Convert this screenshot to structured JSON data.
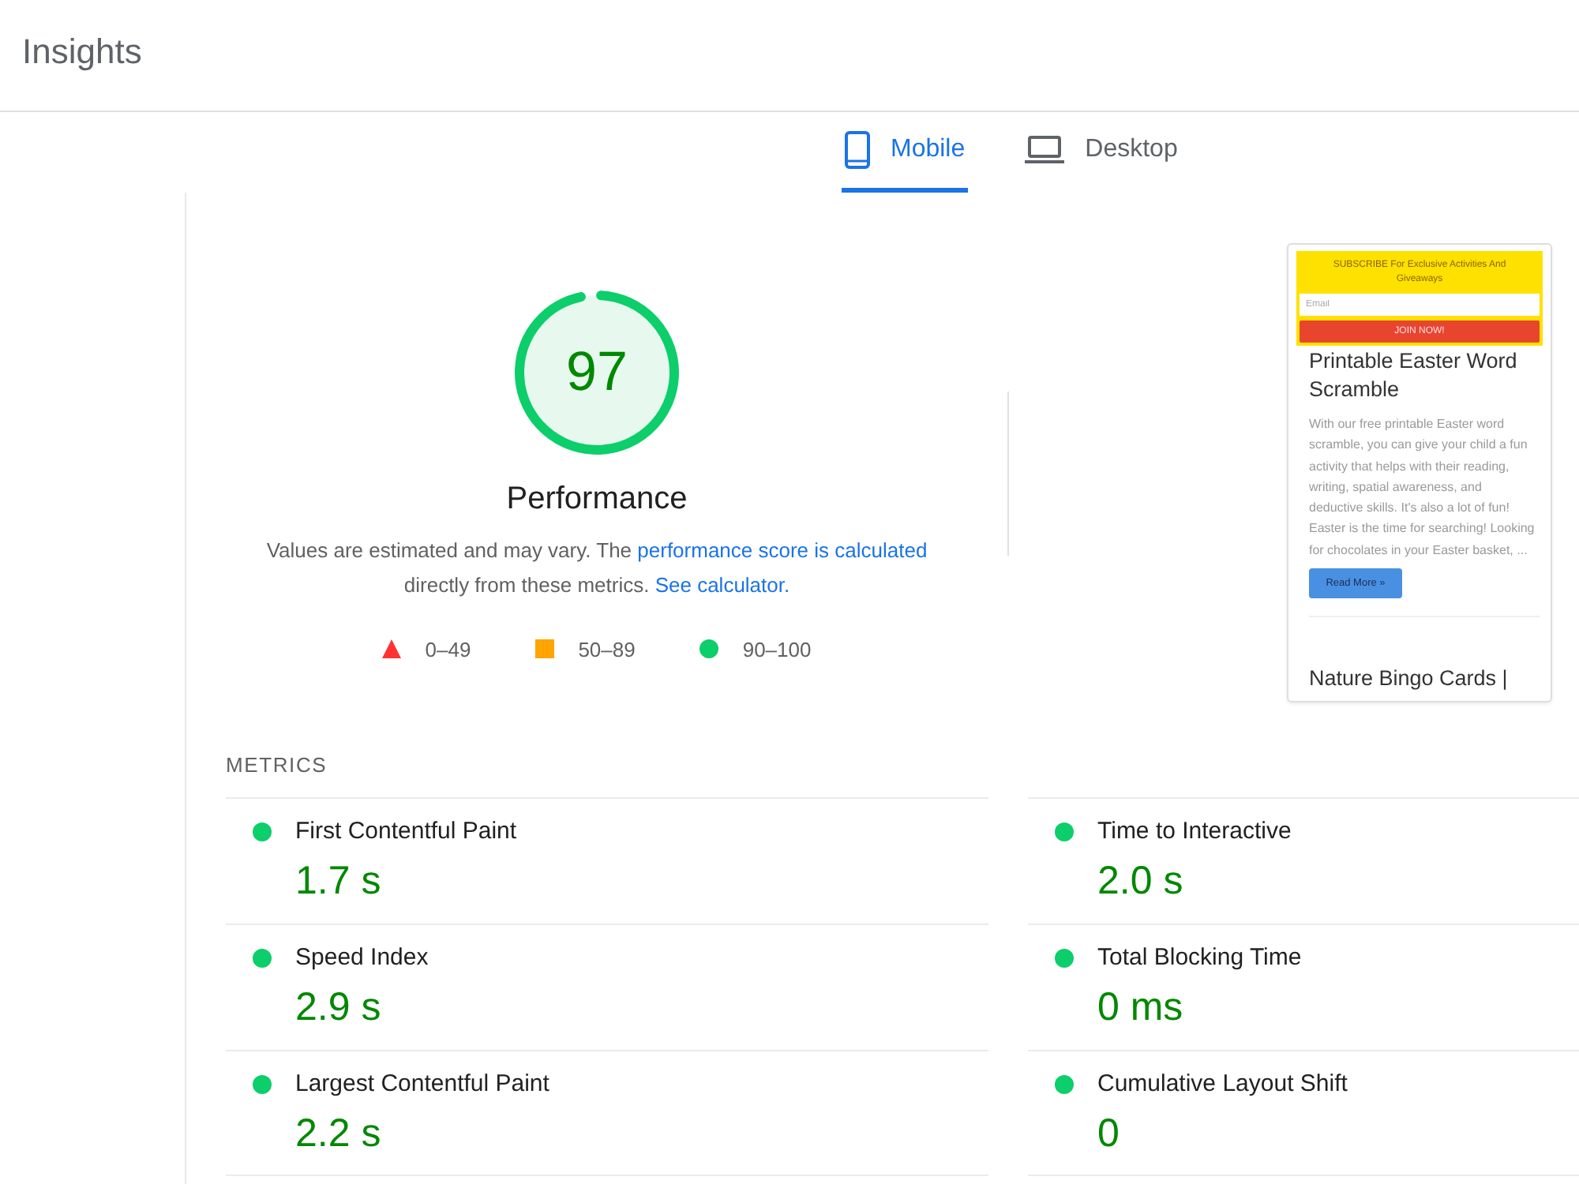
{
  "header": {
    "title": "Insights"
  },
  "tabs": [
    {
      "label": "Mobile",
      "kind": "phone",
      "selected": true
    },
    {
      "label": "Desktop",
      "kind": "laptop",
      "selected": false
    }
  ],
  "score": {
    "value": "97",
    "level": 0.97,
    "title": "Performance",
    "description": [
      {
        "kind": "text",
        "text": "Values are estimated and may vary. The "
      },
      {
        "kind": "link",
        "text": "performance score is calculated"
      },
      {
        "kind": "text",
        "text": " directly from these metrics. "
      },
      {
        "kind": "link",
        "text": "See calculator."
      }
    ],
    "legend": [
      {
        "kind": "triangle",
        "label": "0–49",
        "color": "#ff3333"
      },
      {
        "kind": "square",
        "label": "50–89",
        "color": "#ffa400"
      },
      {
        "kind": "circle",
        "label": "90–100",
        "color": "#0cce6b"
      }
    ]
  },
  "screenshot": {
    "banner_text": "SUBSCRIBE For Exclusive Activities And Giveaways",
    "email_placeholder": "Email",
    "join_button": "JOIN NOW!",
    "post_title": "Printable Easter Word Scramble",
    "excerpt": "With our free printable Easter word scramble, you can give your child a fun activity that helps with their reading, writing, spatial awareness, and deductive skills. It's also a lot of fun! Easter is the time for searching! Looking for chocolates in your Easter basket, ...",
    "read_more": "Read More »",
    "next_title": "Nature Bingo Cards |"
  },
  "metrics": {
    "title": "METRICS",
    "items": [
      {
        "label": "First Contentful Paint",
        "value": "1.7 s",
        "color": "#0cce6b"
      },
      {
        "label": "Time to Interactive",
        "value": "2.0 s",
        "color": "#0cce6b"
      },
      {
        "label": "Speed Index",
        "value": "2.9 s",
        "color": "#0cce6b"
      },
      {
        "label": "Total Blocking Time",
        "value": "0 ms",
        "color": "#0cce6b"
      },
      {
        "label": "Largest Contentful Paint",
        "value": "2.2 s",
        "color": "#0cce6b"
      },
      {
        "label": "Cumulative Layout Shift",
        "value": "0",
        "color": "#0cce6b"
      }
    ]
  }
}
